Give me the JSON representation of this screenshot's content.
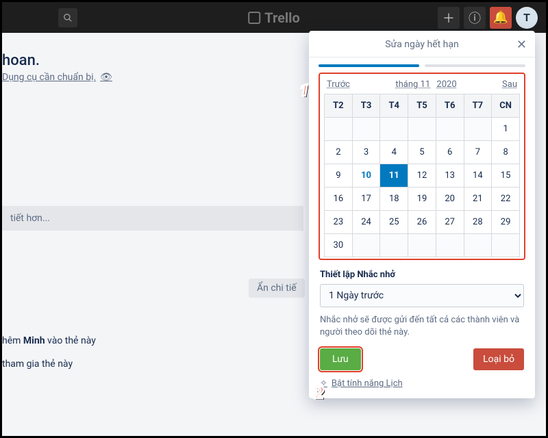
{
  "topbar": {
    "logo_text": "Trello",
    "avatar_initial": "T"
  },
  "card": {
    "title_fragment": "hoan.",
    "subtitle": "Dụng cụ cần chuẩn bị.",
    "description_placeholder": "tiết hơn...",
    "hide_detail_label": "Ẩn chi tiế",
    "activity1_prefix": "hêm ",
    "activity1_bold": "Minh",
    "activity1_suffix": " vào thẻ này",
    "activity2": "tham gia thẻ này"
  },
  "popover": {
    "title": "Sửa ngày hết hạn",
    "calendar": {
      "prev": "Trước",
      "month": "tháng 11",
      "year": "2020",
      "next": "Sau",
      "weekdays": [
        "T2",
        "T3",
        "T4",
        "T5",
        "T6",
        "T7",
        "CN"
      ],
      "weeks": [
        [
          {
            "d": "",
            "oth": true
          },
          {
            "d": "",
            "oth": true
          },
          {
            "d": "",
            "oth": true
          },
          {
            "d": "",
            "oth": true
          },
          {
            "d": "",
            "oth": true
          },
          {
            "d": "",
            "oth": true
          },
          {
            "d": "1"
          }
        ],
        [
          {
            "d": "2"
          },
          {
            "d": "3"
          },
          {
            "d": "4"
          },
          {
            "d": "5"
          },
          {
            "d": "6"
          },
          {
            "d": "7"
          },
          {
            "d": "8"
          }
        ],
        [
          {
            "d": "9"
          },
          {
            "d": "10",
            "today": true
          },
          {
            "d": "11",
            "sel": true
          },
          {
            "d": "12"
          },
          {
            "d": "13"
          },
          {
            "d": "14"
          },
          {
            "d": "15"
          }
        ],
        [
          {
            "d": "16"
          },
          {
            "d": "17"
          },
          {
            "d": "18"
          },
          {
            "d": "19"
          },
          {
            "d": "20"
          },
          {
            "d": "21"
          },
          {
            "d": "22"
          }
        ],
        [
          {
            "d": "23"
          },
          {
            "d": "24"
          },
          {
            "d": "25"
          },
          {
            "d": "26"
          },
          {
            "d": "27"
          },
          {
            "d": "28"
          },
          {
            "d": "29"
          }
        ],
        [
          {
            "d": "30"
          },
          {
            "d": "",
            "oth": true
          },
          {
            "d": "",
            "oth": true
          },
          {
            "d": "",
            "oth": true
          },
          {
            "d": "",
            "oth": true
          },
          {
            "d": "",
            "oth": true
          },
          {
            "d": "",
            "oth": true
          }
        ]
      ]
    },
    "reminder_label": "Thiết lập Nhắc nhở",
    "reminder_value": "1 Ngày trước",
    "reminder_hint": "Nhắc nhở sẽ được gửi đến tất cả các thành viên và người theo dõi thẻ này.",
    "save_label": "Lưu",
    "remove_label": "Loại bỏ",
    "enable_calendar": "Bật tính năng Lịch"
  },
  "annotations": {
    "one": "1",
    "two": "2"
  }
}
